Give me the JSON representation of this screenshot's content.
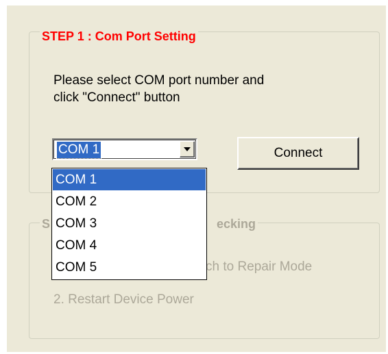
{
  "step1": {
    "legend": "STEP 1 : Com Port Setting",
    "instruction_line1": "Please select COM port number and",
    "instruction_line2": "click \"Connect\" button",
    "combo": {
      "value": "COM 1",
      "options": [
        "COM 1",
        "COM 2",
        "COM 3",
        "COM 4",
        "COM 5"
      ],
      "selected_option": "COM 1",
      "expanded": true
    },
    "connect_button_label": "Connect"
  },
  "step2": {
    "legend_visible": "S",
    "legend_tail_visible": "ecking",
    "item1_visible_tail": "ch to Repair Mode",
    "item2": "2. Restart Device Power",
    "disabled": true
  },
  "colors": {
    "dialog_bg": "#ece9d8",
    "legend_active": "#ff0000",
    "disabled_text": "#aca899",
    "selection": "#316ac5"
  },
  "icons": {
    "combo_arrow": "chevron-down-icon"
  }
}
